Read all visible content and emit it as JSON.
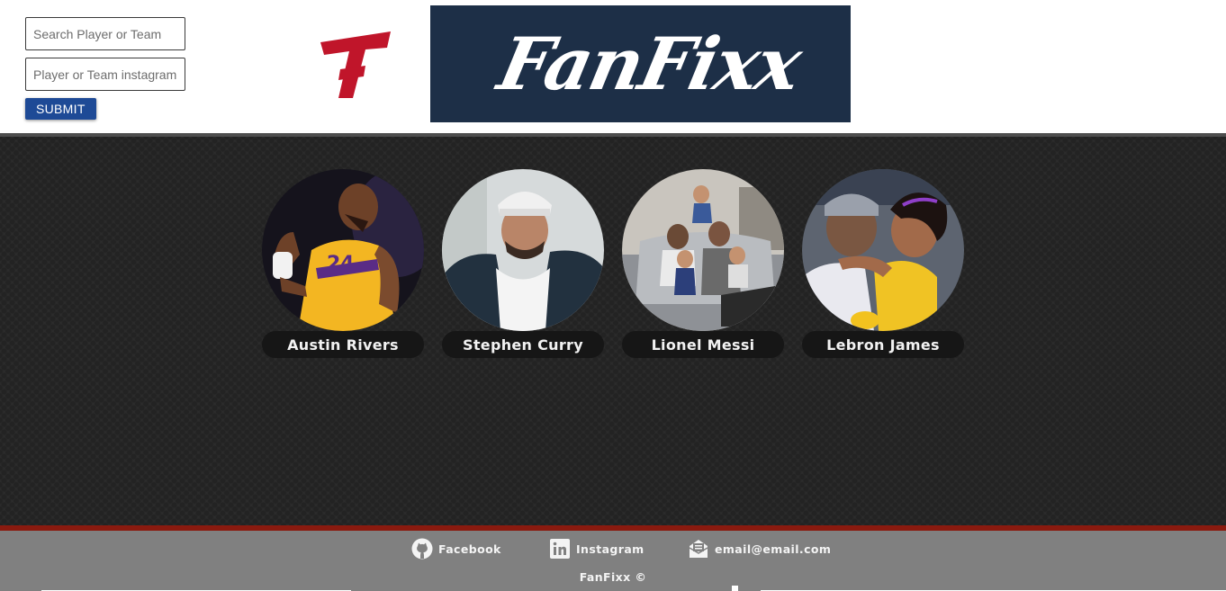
{
  "search": {
    "placeholder": "Search Player or Team",
    "instagram_placeholder": "Player or Team instagram",
    "submit_label": "SUBMIT"
  },
  "brand": {
    "logo_letter": "F",
    "logo_text": "FanFixx",
    "accent_color": "#c0152a",
    "banner_color": "#1d2f47"
  },
  "players": [
    {
      "name": "Austin Rivers",
      "image_icon": "player-photo"
    },
    {
      "name": "Stephen Curry",
      "image_icon": "player-photo"
    },
    {
      "name": "Lionel Messi",
      "image_icon": "player-photo"
    },
    {
      "name": "Lebron James",
      "image_icon": "player-photo"
    }
  ],
  "footer": {
    "links": [
      {
        "label": "Facebook",
        "icon": "github-icon"
      },
      {
        "label": "Instagram",
        "icon": "linkedin-icon"
      },
      {
        "label": "email@email.com",
        "icon": "envelope-icon"
      }
    ],
    "copyright": "FanFixx ©"
  }
}
